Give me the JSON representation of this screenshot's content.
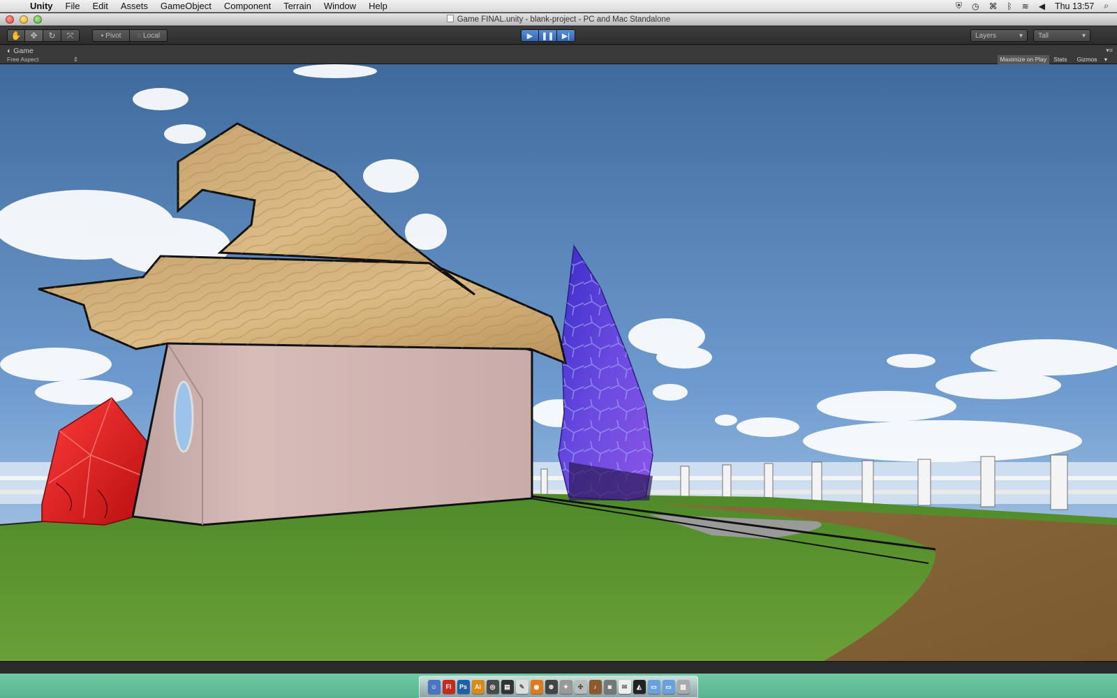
{
  "menubar": {
    "app_name": "Unity",
    "items": [
      "File",
      "Edit",
      "Assets",
      "GameObject",
      "Component",
      "Terrain",
      "Window",
      "Help"
    ],
    "clock": "Thu 13:57"
  },
  "window": {
    "title": "Game FINAL.unity - blank-project - PC and Mac Standalone"
  },
  "toolbar": {
    "pivot_label": "Pivot",
    "local_label": "Local",
    "layers_label": "Layers",
    "layout_label": "Tall"
  },
  "game_view": {
    "tab_label": "Game",
    "aspect_label": "Free Aspect",
    "maximize_label": "Maximize on Play",
    "stats_label": "Stats",
    "gizmos_label": "Gizmos"
  },
  "dock": {
    "icons": [
      "Fl",
      "Ps",
      "Ai"
    ]
  },
  "colors": {
    "play_accent": "#3d76c9",
    "dock_background": "#62bd98",
    "sky_top": "#3f6a9c",
    "grass": "#5e962f"
  }
}
